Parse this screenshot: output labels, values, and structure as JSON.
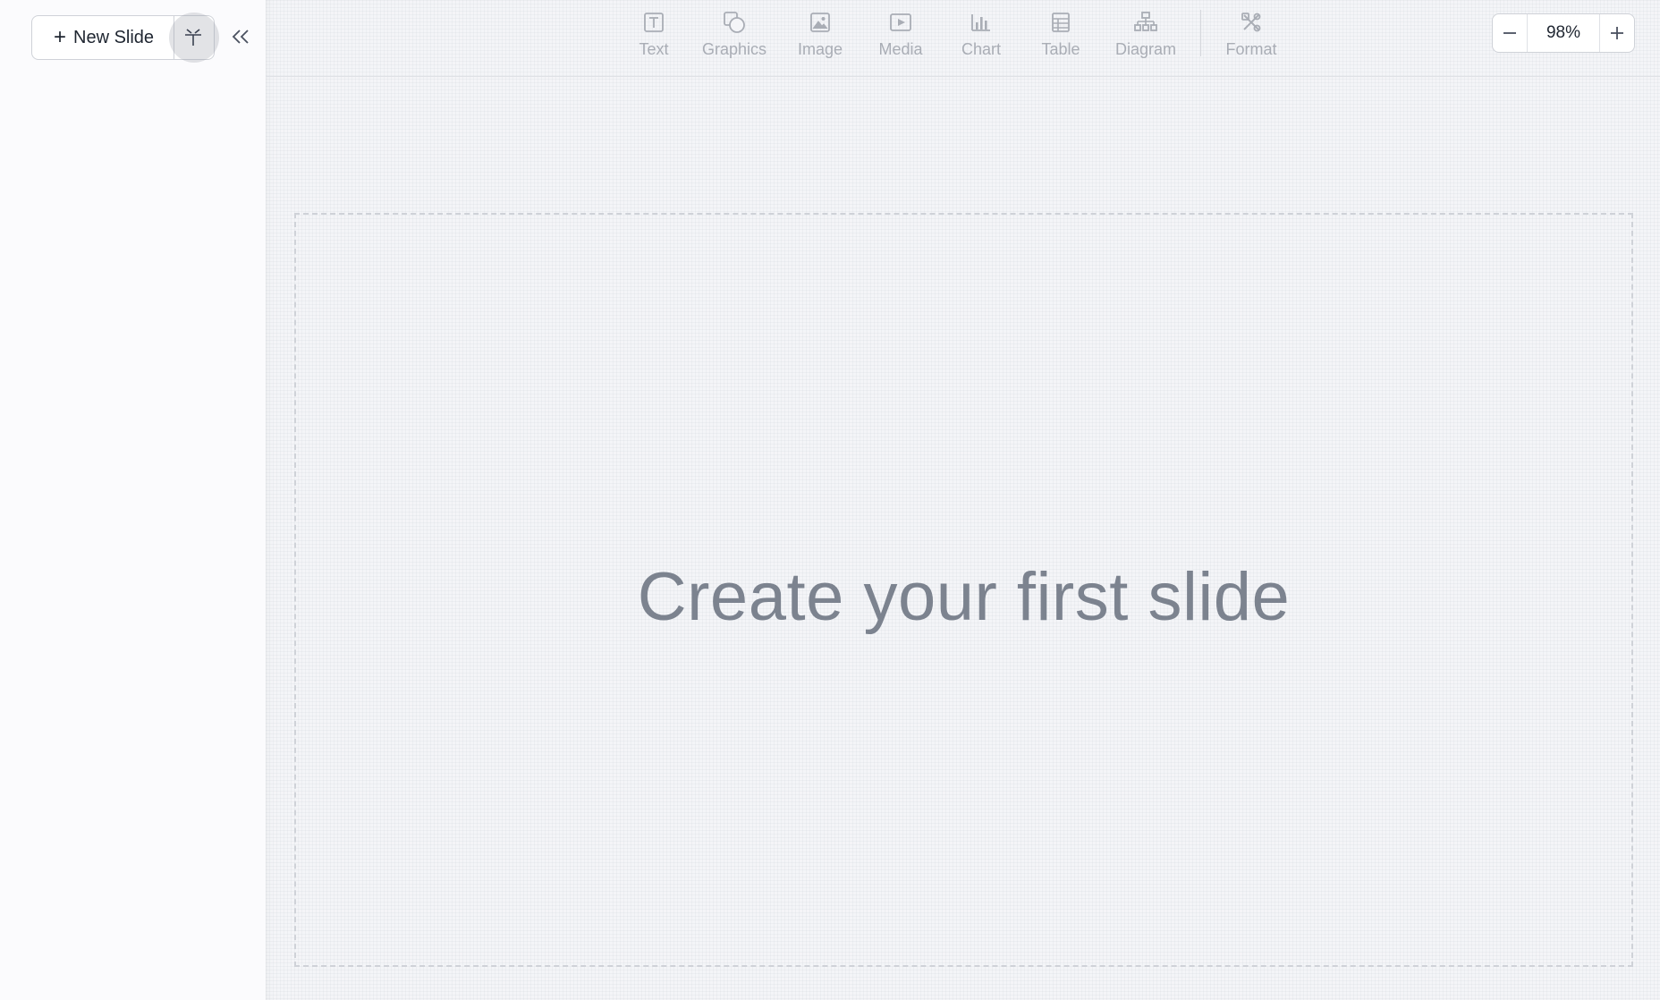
{
  "sidebar": {
    "new_slide_label": "New Slide",
    "layout_icon": "layout-icon",
    "collapse_icon": "chevrons-left-icon"
  },
  "toolbar": {
    "tools": [
      {
        "label": "Text",
        "icon": "text-icon"
      },
      {
        "label": "Graphics",
        "icon": "shapes-icon"
      },
      {
        "label": "Image",
        "icon": "image-icon"
      },
      {
        "label": "Media",
        "icon": "play-icon"
      },
      {
        "label": "Chart",
        "icon": "bar-chart-icon"
      },
      {
        "label": "Table",
        "icon": "table-icon"
      },
      {
        "label": "Diagram",
        "icon": "org-chart-icon"
      },
      {
        "label": "Format",
        "icon": "paint-tools-icon"
      }
    ]
  },
  "zoom": {
    "value": "98%",
    "decrease_icon": "minus-icon",
    "increase_icon": "plus-icon"
  },
  "canvas": {
    "prompt": "Create your first slide"
  },
  "colors": {
    "tool_disabled": "#a9adb5",
    "prompt_text": "#7c838f",
    "border": "#cfd2d8"
  }
}
